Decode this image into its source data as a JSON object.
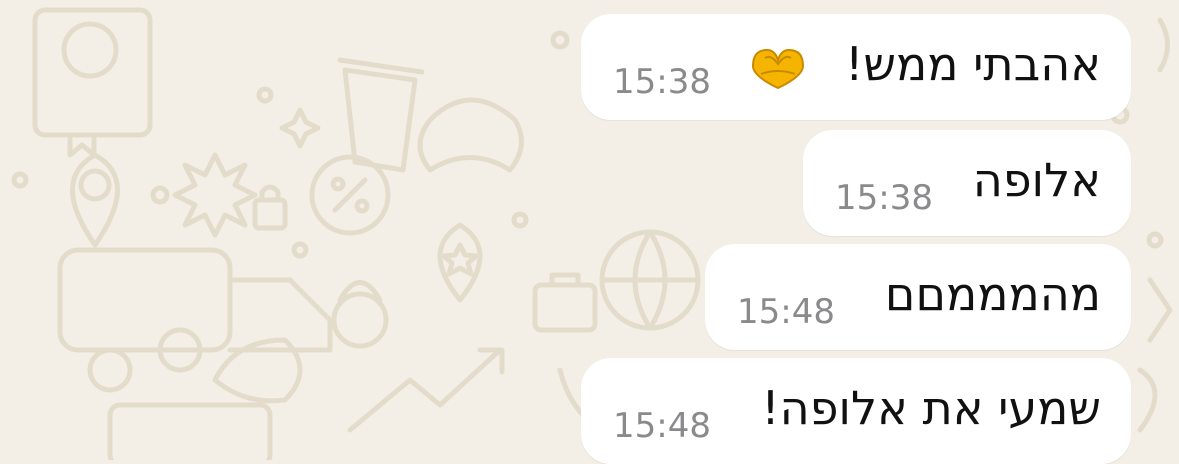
{
  "messages": [
    {
      "text": "אהבתי ממש!",
      "time": "15:38",
      "emoji": "heart-hands"
    },
    {
      "text": "אלופה",
      "time": "15:38"
    },
    {
      "text": "מהמממםם",
      "time": "15:48"
    },
    {
      "text": "שמעי את אלופה!",
      "time": "15:48"
    }
  ],
  "colors": {
    "background": "#f3efe7",
    "doodle": "#e4dccb",
    "bubble": "#ffffff",
    "text": "#111111",
    "time": "#8a8a8d"
  }
}
